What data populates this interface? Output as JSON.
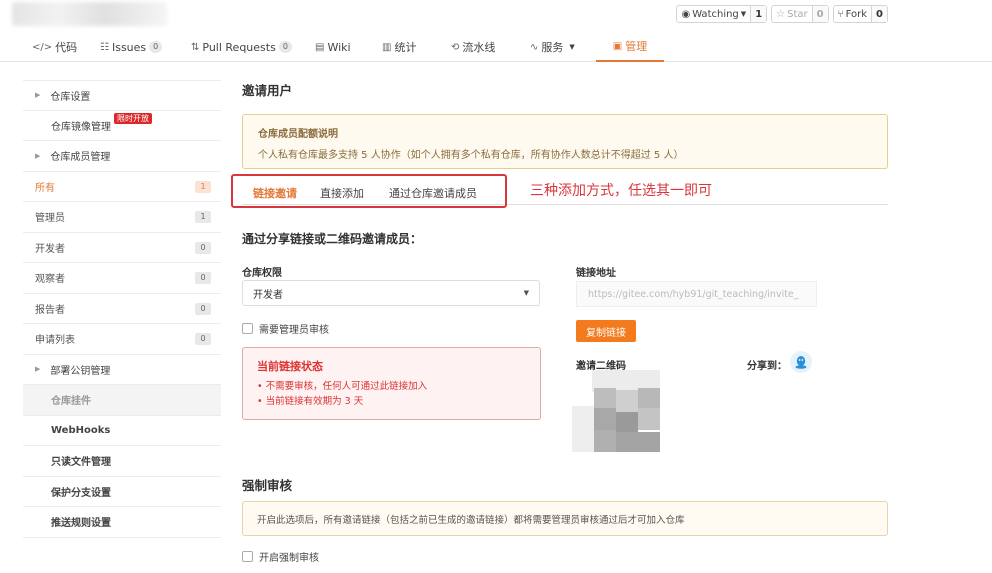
{
  "topbar": {
    "watching": {
      "label": "Watching",
      "count": "1"
    },
    "star": {
      "label": "Star",
      "count": "0"
    },
    "fork": {
      "label": "Fork",
      "count": "0"
    }
  },
  "nav": {
    "code": "代码",
    "issues": "Issues",
    "issues_count": "0",
    "pull_requests": "Pull Requests",
    "pull_requests_count": "0",
    "wiki": "Wiki",
    "stats": "统计",
    "pipeline": "流水线",
    "service": "服务",
    "manage": "管理"
  },
  "sidebar": {
    "repo_settings": "仓库设置",
    "mirror_manage": "仓库镜像管理",
    "promo_badge": "限时开放",
    "member_manage": "仓库成员管理",
    "members": [
      {
        "label": "所有",
        "count": "1"
      },
      {
        "label": "管理员",
        "count": "1"
      },
      {
        "label": "开发者",
        "count": "0"
      },
      {
        "label": "观察者",
        "count": "0"
      },
      {
        "label": "报告者",
        "count": "0"
      },
      {
        "label": "申请列表",
        "count": "0"
      }
    ],
    "deploy_keys": "部署公钥管理",
    "widgets": "仓库挂件",
    "webhooks": "WebHooks",
    "readonly_files": "只读文件管理",
    "protected_branches": "保护分支设置",
    "push_rules": "推送规则设置"
  },
  "main": {
    "title": "邀请用户",
    "quota_title": "仓库成员配额说明",
    "quota_text": "个人私有仓库最多支持 5 人协作（如个人拥有多个私有仓库，所有协作人数总计不得超过 5 人）",
    "tabs": [
      "链接邀请",
      "直接添加",
      "通过仓库邀请成员"
    ],
    "annotation": "三种添加方式，任选其一即可",
    "share_heading": "通过分享链接或二维码邀请成员：",
    "permission_label": "仓库权限",
    "permission_value": "开发者",
    "require_admin_review": "需要管理员审核",
    "status_title": "当前链接状态",
    "status_items": [
      "不需要审核，任何人可通过此链接加入",
      "当前链接有效期为 3 天"
    ],
    "link_label": "链接地址",
    "link_value": "https://gitee.com/hyb91/git_teaching/invite_",
    "copy_button": "复制链接",
    "qr_label": "邀请二维码",
    "share_label": "分享到：",
    "force_review_title": "强制审核",
    "force_review_notice": "开启此选项后，所有邀请链接（包括之前已生成的邀请链接）都将需要管理员审核通过后才可加入仓库",
    "enable_force_review": "开启强制审核"
  },
  "colors": {
    "accent": "#e37938",
    "annotation": "#d9363e"
  }
}
